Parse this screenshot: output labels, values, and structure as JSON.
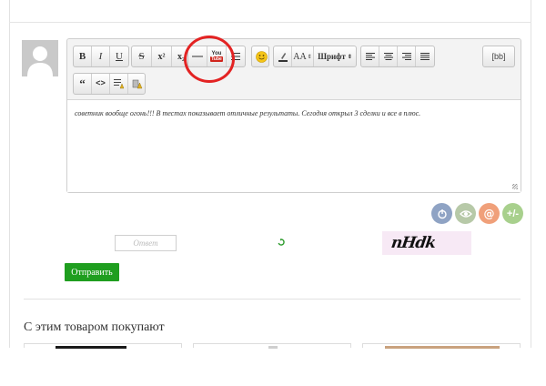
{
  "editor": {
    "toolbar": {
      "bold": "B",
      "italic": "I",
      "underline": "U",
      "strike": "S",
      "superscript": "x²",
      "subscript": "x₂",
      "youtube_top": "You",
      "youtube_bottom": "Tube",
      "font_size": "AA",
      "font_label": "Шрифт",
      "bb": "[bb]",
      "code": "<>"
    },
    "text": "советник вообще огонь!!! В тестах показывает отличные результаты. Сегодня открыл 3 сделки и все в плюс."
  },
  "form": {
    "reply_placeholder": "Ответ",
    "captcha_text": "nHdk",
    "submit_label": "Отправить"
  },
  "share": [
    {
      "name": "share-icon-1",
      "color": "#8fa3c4"
    },
    {
      "name": "share-icon-2",
      "color": "#b7c9a8"
    },
    {
      "name": "share-icon-3",
      "color": "#f0a07a"
    },
    {
      "name": "share-icon-4",
      "color": "#a8d08d"
    }
  ],
  "section": {
    "title": "С этим товаром покупают"
  },
  "colors": {
    "submit": "#1f9e1f",
    "callout": "#e32323",
    "captcha_bg": "#f7e9f5"
  }
}
